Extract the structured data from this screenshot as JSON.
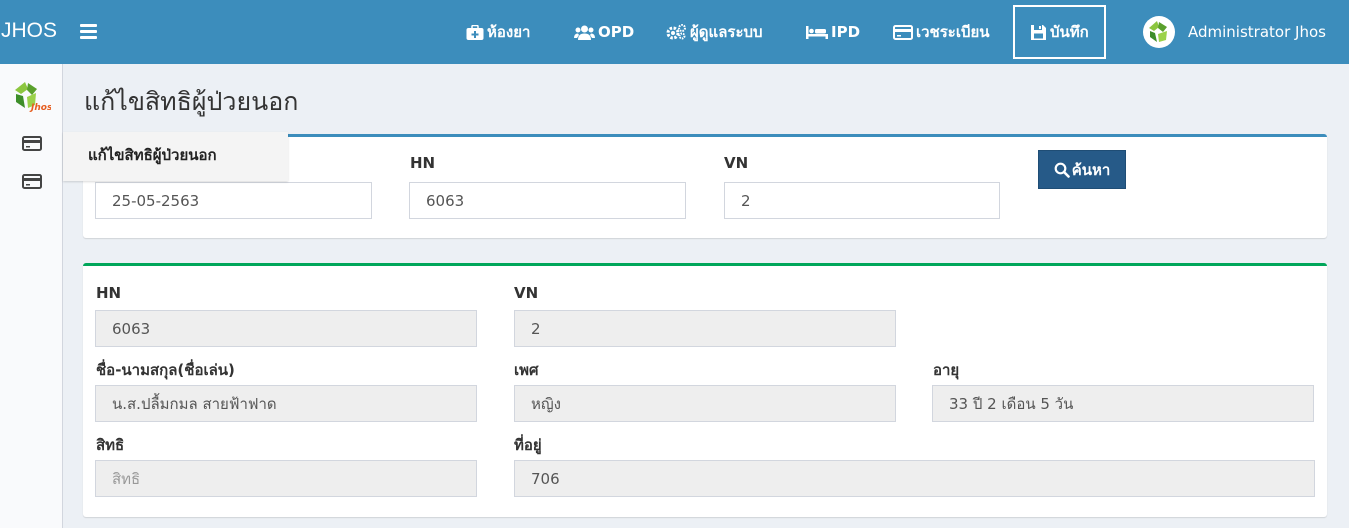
{
  "brand": "JHOS",
  "header": {
    "nav": [
      {
        "label": "ห้องยา",
        "icon": "medkit-icon"
      },
      {
        "label": "OPD",
        "icon": "users-icon"
      },
      {
        "label": "ผู้ดูแลระบบ",
        "icon": "cogs-icon"
      },
      {
        "label": "IPD",
        "icon": "bed-icon"
      },
      {
        "label": "เวชระเบียน",
        "icon": "credit-card-icon"
      },
      {
        "label": "บันทึก",
        "icon": "save-icon",
        "active": true
      }
    ],
    "user_name": "Administrator Jhos"
  },
  "sidebar": {
    "logo_text": "Jhos",
    "tooltip": "แก้ไขสิทธิผู้ป่วยนอก"
  },
  "page": {
    "title": "แก้ไขสิทธิผู้ป่วยนอก"
  },
  "search": {
    "date_value": "25-05-2563",
    "hn_label": "HN",
    "hn_value": "6063",
    "vn_label": "VN",
    "vn_value": "2",
    "button_label": "ค้นหา"
  },
  "patient": {
    "hn_label": "HN",
    "hn_value": "6063",
    "vn_label": "VN",
    "vn_value": "2",
    "name_label": "ชื่อ-นามสกุล(ชื่อเล่น)",
    "name_value": "น.ส.ปลื้มกมล  สายฟ้าฟาด",
    "sex_label": "เพศ",
    "sex_value": "หญิง",
    "age_label": "อายุ",
    "age_value": "33 ปี 2 เดือน 5 วัน",
    "right_label": "สิทธิ",
    "right_placeholder": "สิทธิ",
    "address_label": "ที่อยู่",
    "address_value": "706"
  },
  "colors": {
    "header": "#3c8dbc",
    "search_box_border": "#3c8dbc",
    "info_box_border": "#00a65a",
    "search_button": "#265a88"
  }
}
